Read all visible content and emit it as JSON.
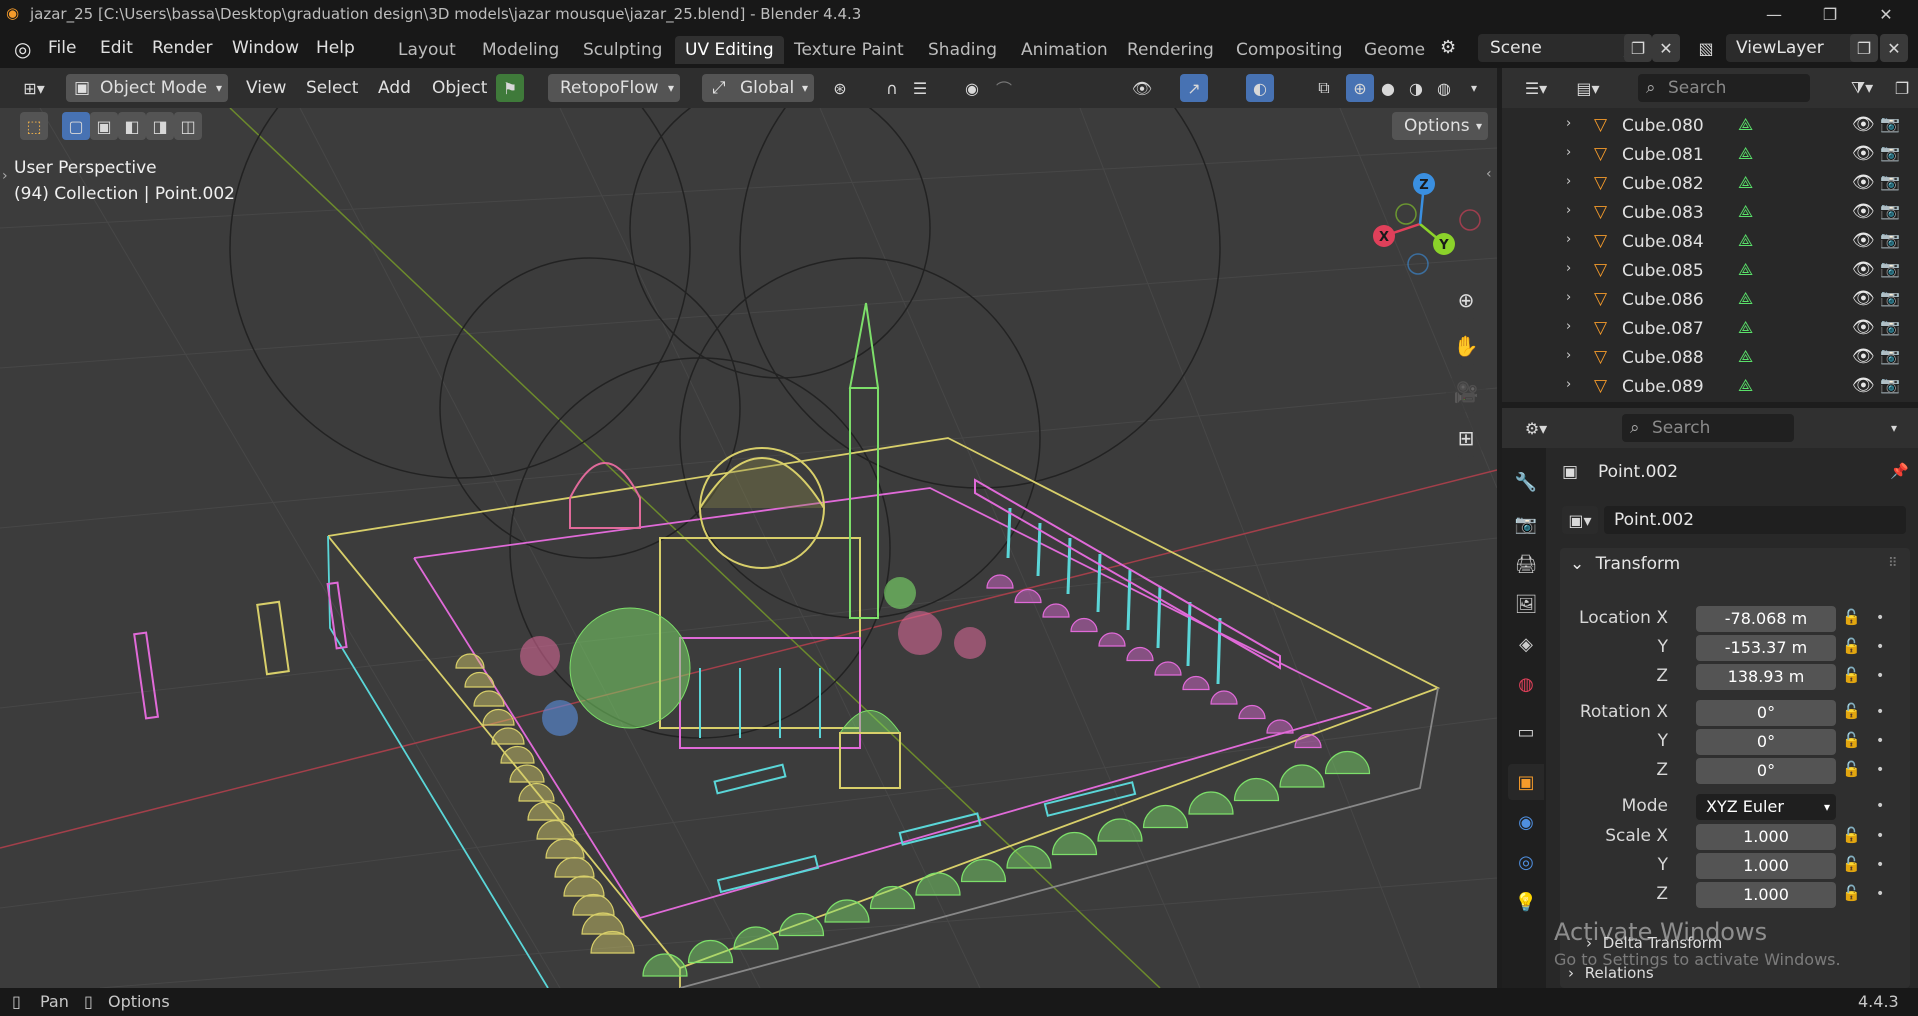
{
  "titlebar": {
    "title": "jazar_25 [C:\\Users\\bassa\\Desktop\\graduation design\\3D models\\jazar mousque\\jazar_25.blend] - Blender 4.4.3",
    "min_glyph": "—",
    "max_glyph": "❐",
    "close_glyph": "✕"
  },
  "menu": [
    "File",
    "Edit",
    "Render",
    "Window",
    "Help"
  ],
  "workspaces": [
    "Layout",
    "Modeling",
    "Sculpting",
    "UV Editing",
    "Texture Paint",
    "Shading",
    "Animation",
    "Rendering",
    "Compositing",
    "Geome"
  ],
  "active_workspace": "UV Editing",
  "scene": {
    "name": "Scene"
  },
  "view_layer": {
    "name": "ViewLayer"
  },
  "header3d": {
    "mode": "Object Mode",
    "menus": [
      "View",
      "Select",
      "Add",
      "Object"
    ],
    "retopoflow": "RetopoFlow",
    "orientation": "Global",
    "options": "Options"
  },
  "viewport": {
    "perspective": "User Perspective",
    "collection_info": "(94) Collection | Point.002",
    "watermark_title": "Activate Windows",
    "watermark_sub": "Go to Settings to activate Windows.",
    "gizmo": {
      "x": "X",
      "y": "Y",
      "z": "Z"
    }
  },
  "outliner": {
    "search_placeholder": "Search",
    "items": [
      "Cube.080",
      "Cube.081",
      "Cube.082",
      "Cube.083",
      "Cube.084",
      "Cube.085",
      "Cube.086",
      "Cube.087",
      "Cube.088",
      "Cube.089"
    ]
  },
  "properties": {
    "search_placeholder": "Search",
    "object_name": "Point.002",
    "datablock_name": "Point.002",
    "transform_label": "Transform",
    "location": {
      "label": "Location X",
      "x": "-78.068 m",
      "y": "-153.37 m",
      "z": "138.93 m"
    },
    "rotation": {
      "label": "Rotation X",
      "x": "0°",
      "y": "0°",
      "z": "0°"
    },
    "mode_label": "Mode",
    "mode_value": "XYZ Euler",
    "scale": {
      "label": "Scale X",
      "x": "1.000",
      "y": "1.000",
      "z": "1.000"
    },
    "axis_y": "Y",
    "axis_z": "Z",
    "delta_transform": "Delta Transform",
    "relations": "Relations"
  },
  "statusbar": {
    "pan": "Pan",
    "options": "Options",
    "version": "4.4.3"
  },
  "colors": {
    "accent": "#4772b3",
    "wire_green": "#7ddf6a",
    "wire_yellow": "#d8cf6a",
    "wire_pink": "#e06ad8",
    "wire_cyan": "#5ad6d8",
    "axis_x": "#e0405a",
    "axis_y": "#8bd22a",
    "axis_z": "#3a8fe0"
  }
}
